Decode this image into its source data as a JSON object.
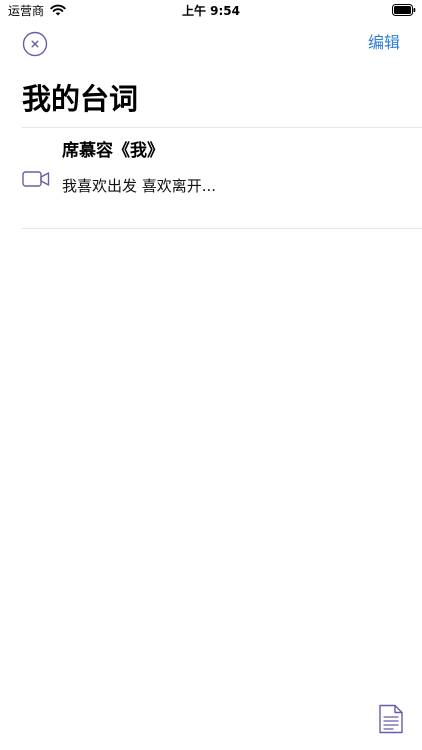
{
  "status_bar": {
    "carrier": "运营商",
    "time": "上午 9:54",
    "icons": [
      "wifi-icon",
      "battery-icon"
    ]
  },
  "nav": {
    "close_icon": "close-circle-icon",
    "edit_label": "编辑"
  },
  "page": {
    "title": "我的台词"
  },
  "list": {
    "items": [
      {
        "icon": "video-camera-icon",
        "title": "席慕容《我》",
        "subtitle": "我喜欢出发 喜欢离开..."
      }
    ]
  },
  "bottom": {
    "doc_icon": "document-icon"
  },
  "colors": {
    "accent": "#2f7fd6",
    "icon_purple": "#6b5ba8",
    "divider": "#e6e6e6"
  }
}
